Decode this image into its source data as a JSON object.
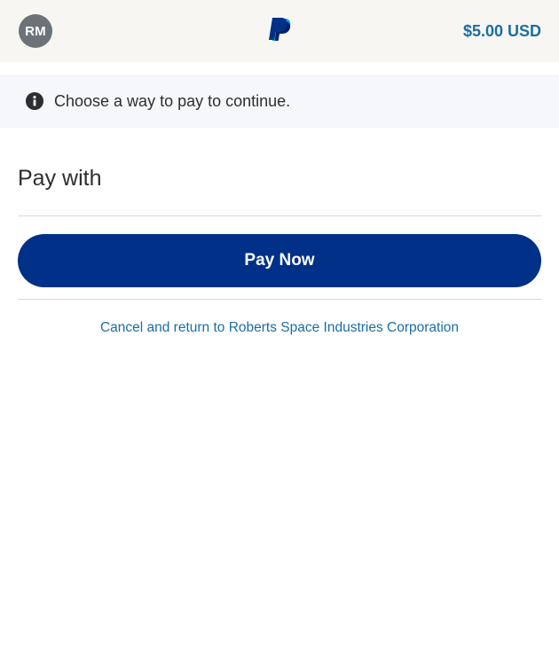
{
  "header": {
    "avatar_initials": "RM",
    "logo_icon": "paypal-logo-icon",
    "amount": "$5.00 USD"
  },
  "notice": {
    "icon": "info-icon",
    "text": "Choose a way to pay to continue."
  },
  "payment": {
    "heading": "Pay with",
    "pay_button_label": "Pay Now",
    "cancel_link": "Cancel and return to Roberts Space Industries Corporation"
  },
  "colors": {
    "brand_navy": "#003087",
    "link_blue": "#1a6ea4",
    "avatar_gray": "#6c7378",
    "header_bg": "#f7f6f3",
    "notice_bg": "#f5f7fa"
  }
}
